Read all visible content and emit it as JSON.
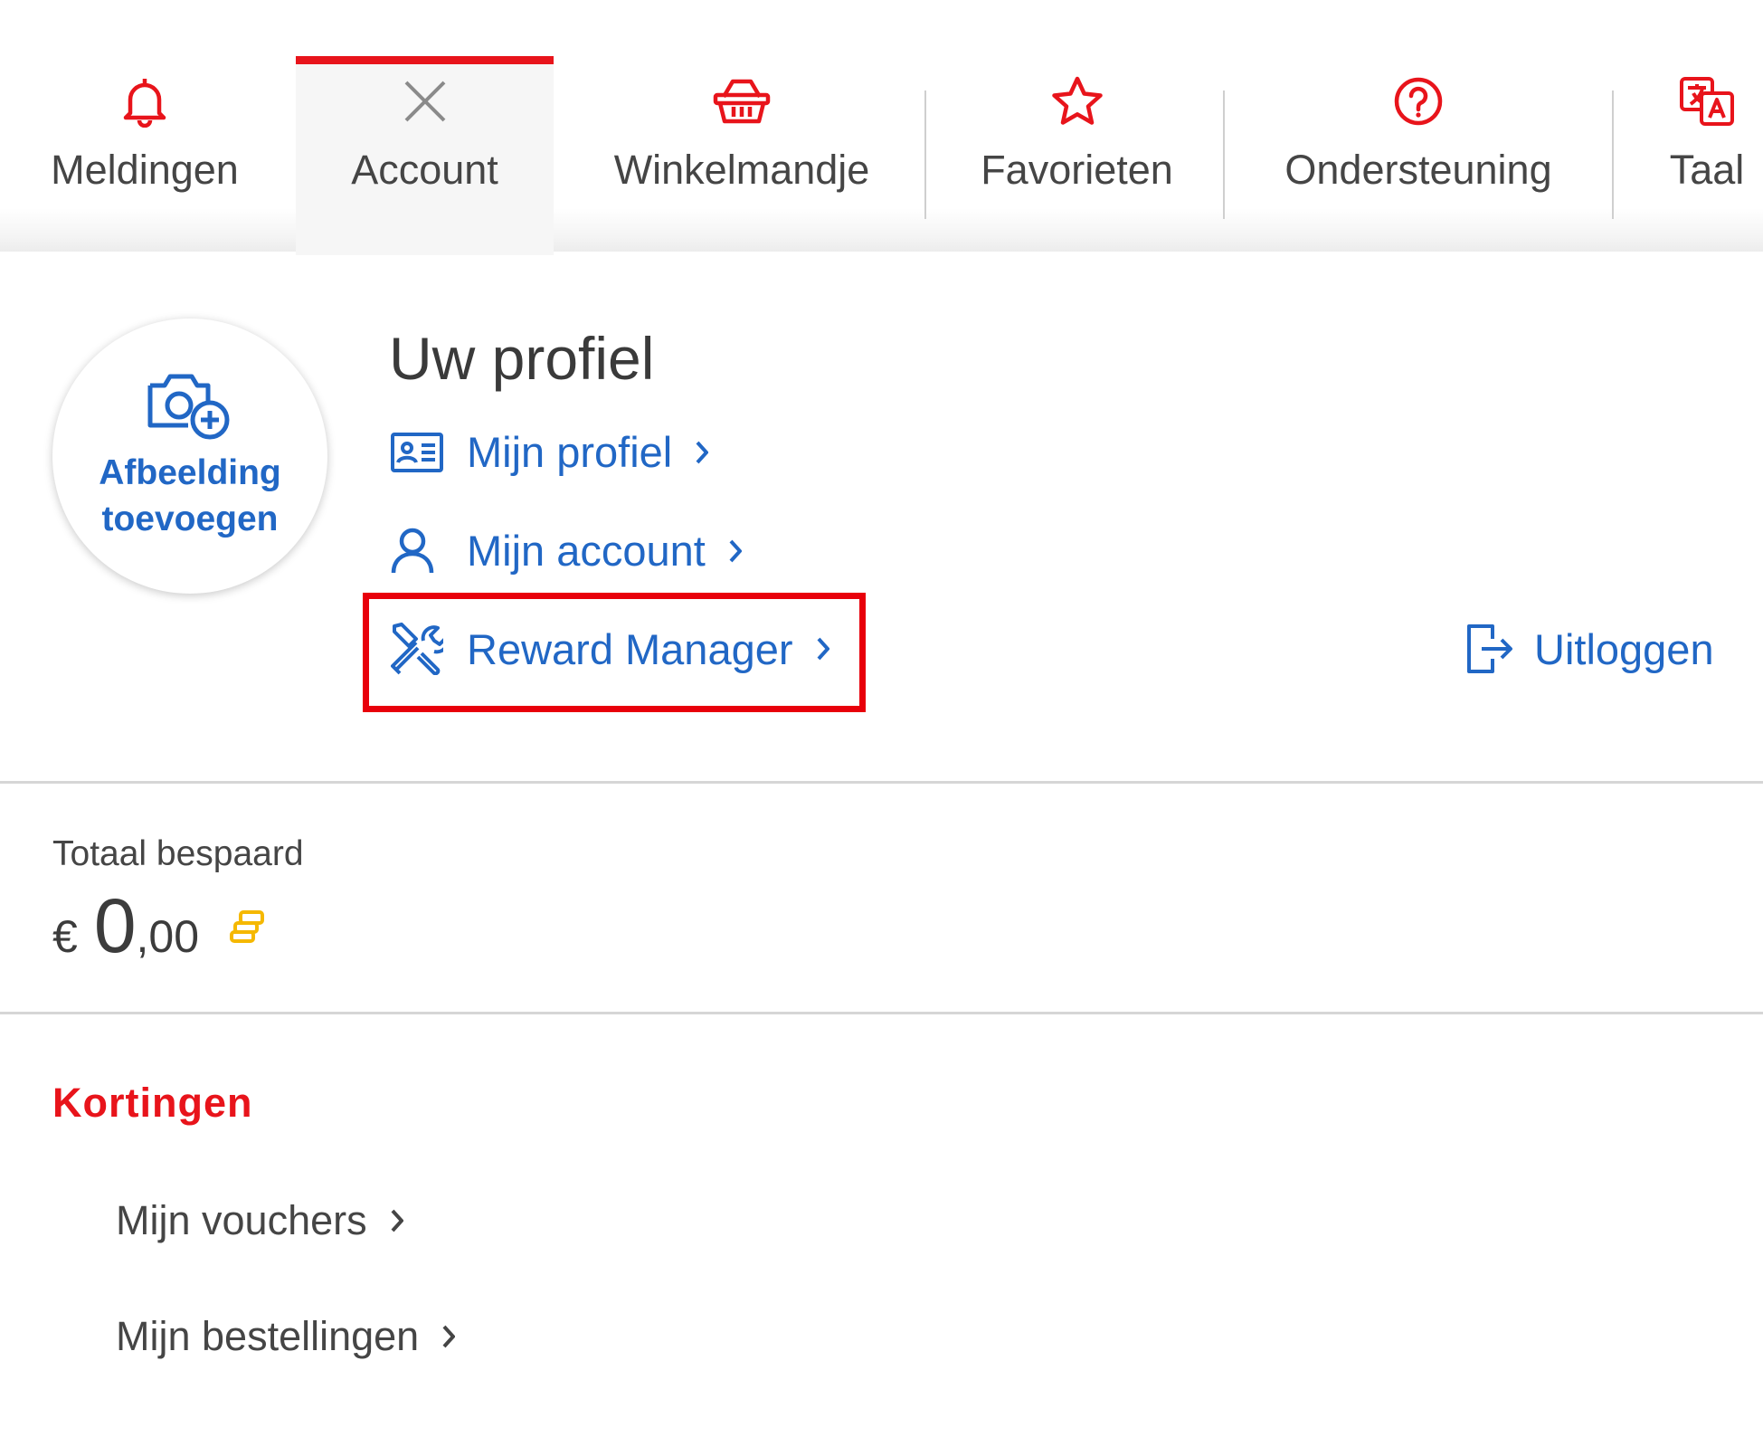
{
  "nav": {
    "tabs": [
      {
        "label": "Meldingen",
        "icon": "bell-icon"
      },
      {
        "label": "Account",
        "icon": "close-icon",
        "active": true
      },
      {
        "label": "Winkelmandje",
        "icon": "basket-icon"
      },
      {
        "label": "Favorieten",
        "icon": "star-icon"
      },
      {
        "label": "Ondersteuning",
        "icon": "help-icon"
      },
      {
        "label": "Taal",
        "icon": "translate-icon"
      }
    ]
  },
  "profile": {
    "avatar_label_line1": "Afbeelding",
    "avatar_label_line2": "toevoegen",
    "title": "Uw profiel",
    "links": [
      {
        "label": "Mijn profiel",
        "icon": "id-card-icon"
      },
      {
        "label": "Mijn account",
        "icon": "user-icon"
      },
      {
        "label": "Reward Manager",
        "icon": "tools-icon",
        "highlighted": true
      }
    ],
    "logout_label": "Uitloggen"
  },
  "savings": {
    "label": "Totaal bespaard",
    "currency": "€",
    "integer": "0",
    "decimal": ",00"
  },
  "discounts": {
    "title": "Kortingen",
    "links": [
      {
        "label": "Mijn vouchers"
      },
      {
        "label": "Mijn bestellingen"
      }
    ]
  },
  "colors": {
    "brand_red": "#e8141b",
    "link_blue": "#2167c5",
    "coin_yellow": "#f5b800",
    "highlight_red": "#e8000b"
  }
}
